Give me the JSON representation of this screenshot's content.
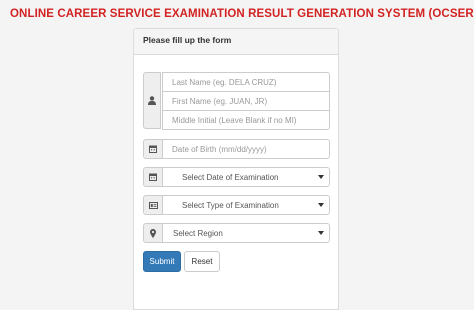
{
  "app": {
    "title": "ONLINE CAREER SERVICE EXAMINATION RESULT GENERATION SYSTEM (OCSERGS)"
  },
  "form": {
    "heading": "Please fill up the form",
    "name_group_icon": "user-icon",
    "last_name_placeholder": "Last Name     (eg. DELA CRUZ)",
    "first_name_placeholder": "First Name     (eg. JUAN, JR)",
    "middle_initial_placeholder": "Middle Initial    (Leave Blank if no MI)",
    "dob_icon": "calendar-icon",
    "dob_placeholder": "Date of Birth   (mm/dd/yyyy)",
    "exam_date_icon": "calendar-icon",
    "exam_date_selected": "Select Date of Examination",
    "exam_type_icon": "id-card-icon",
    "exam_type_selected": "Select Type of Examination",
    "region_icon": "map-marker-icon",
    "region_selected": "Select Region",
    "submit_label": "Submit",
    "reset_label": "Reset"
  },
  "colors": {
    "title_red": "#d32222",
    "primary_blue": "#337ab7"
  }
}
